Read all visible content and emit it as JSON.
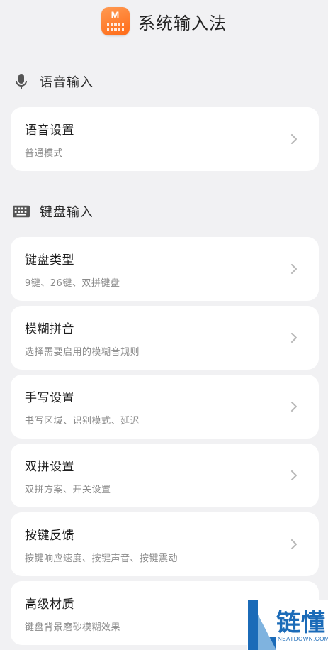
{
  "header": {
    "logo_text": "M",
    "title": "系统输入法"
  },
  "sections": {
    "voice": {
      "icon": "microphone-icon",
      "title": "语音输入",
      "items": [
        {
          "title": "语音设置",
          "subtitle": "普通模式"
        }
      ]
    },
    "keyboard": {
      "icon": "keyboard-icon",
      "title": "键盘输入",
      "items": [
        {
          "title": "键盘类型",
          "subtitle": "9键、26键、双拼键盘"
        },
        {
          "title": "模糊拼音",
          "subtitle": "选择需要启用的模糊音规则"
        },
        {
          "title": "手写设置",
          "subtitle": "书写区域、识别模式、延迟"
        },
        {
          "title": "双拼设置",
          "subtitle": "双拼方案、开关设置"
        },
        {
          "title": "按键反馈",
          "subtitle": "按键响应速度、按键声音、按键震动"
        },
        {
          "title": "高级材质",
          "subtitle": "键盘背景磨砂模糊效果"
        }
      ]
    }
  },
  "watermark": {
    "text": "链懂",
    "url": "NEATDOWN.COM"
  },
  "colors": {
    "accent": "#ff7a24",
    "background": "#f1f1f3",
    "card": "#ffffff",
    "subtitle": "#8a8a8a",
    "watermark": "#1b6bb8"
  }
}
